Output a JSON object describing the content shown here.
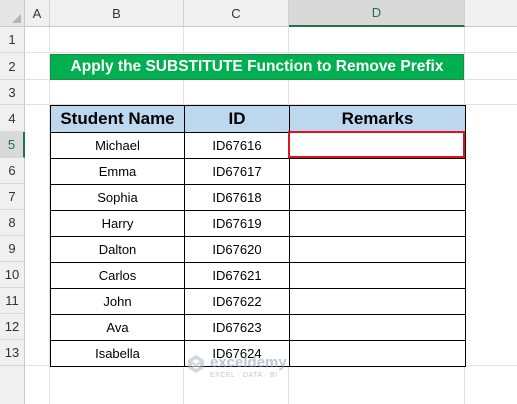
{
  "sheet": {
    "columns": [
      "A",
      "B",
      "C",
      "D"
    ],
    "selected_column": "D",
    "rows": [
      "1",
      "2",
      "3",
      "4",
      "5",
      "6",
      "7",
      "8",
      "9",
      "10",
      "11",
      "12",
      "13"
    ],
    "selected_row": "5"
  },
  "title": "Apply the SUBSTITUTE Function to Remove Prefix",
  "table": {
    "headers": [
      "Student Name",
      "ID",
      "Remarks"
    ],
    "rows": [
      {
        "name": "Michael",
        "id": "ID67616",
        "remarks": ""
      },
      {
        "name": "Emma",
        "id": "ID67617",
        "remarks": ""
      },
      {
        "name": "Sophia",
        "id": "ID67618",
        "remarks": ""
      },
      {
        "name": "Harry",
        "id": "ID67619",
        "remarks": ""
      },
      {
        "name": "Dalton",
        "id": "ID67620",
        "remarks": ""
      },
      {
        "name": "Carlos",
        "id": "ID67621",
        "remarks": ""
      },
      {
        "name": "John",
        "id": "ID67622",
        "remarks": ""
      },
      {
        "name": "Ava",
        "id": "ID67623",
        "remarks": ""
      },
      {
        "name": "Isabella",
        "id": "ID67624",
        "remarks": ""
      }
    ]
  },
  "selected_cell": "D5",
  "watermark": {
    "name": "exceldemy",
    "tagline": "EXCEL · DATA · BI",
    "icon": "exceldemy-logo-icon"
  },
  "colors": {
    "title_bg": "#00b050",
    "header_bg": "#bdd7ee",
    "selection_border": "#e0141e",
    "excel_green": "#217346"
  }
}
